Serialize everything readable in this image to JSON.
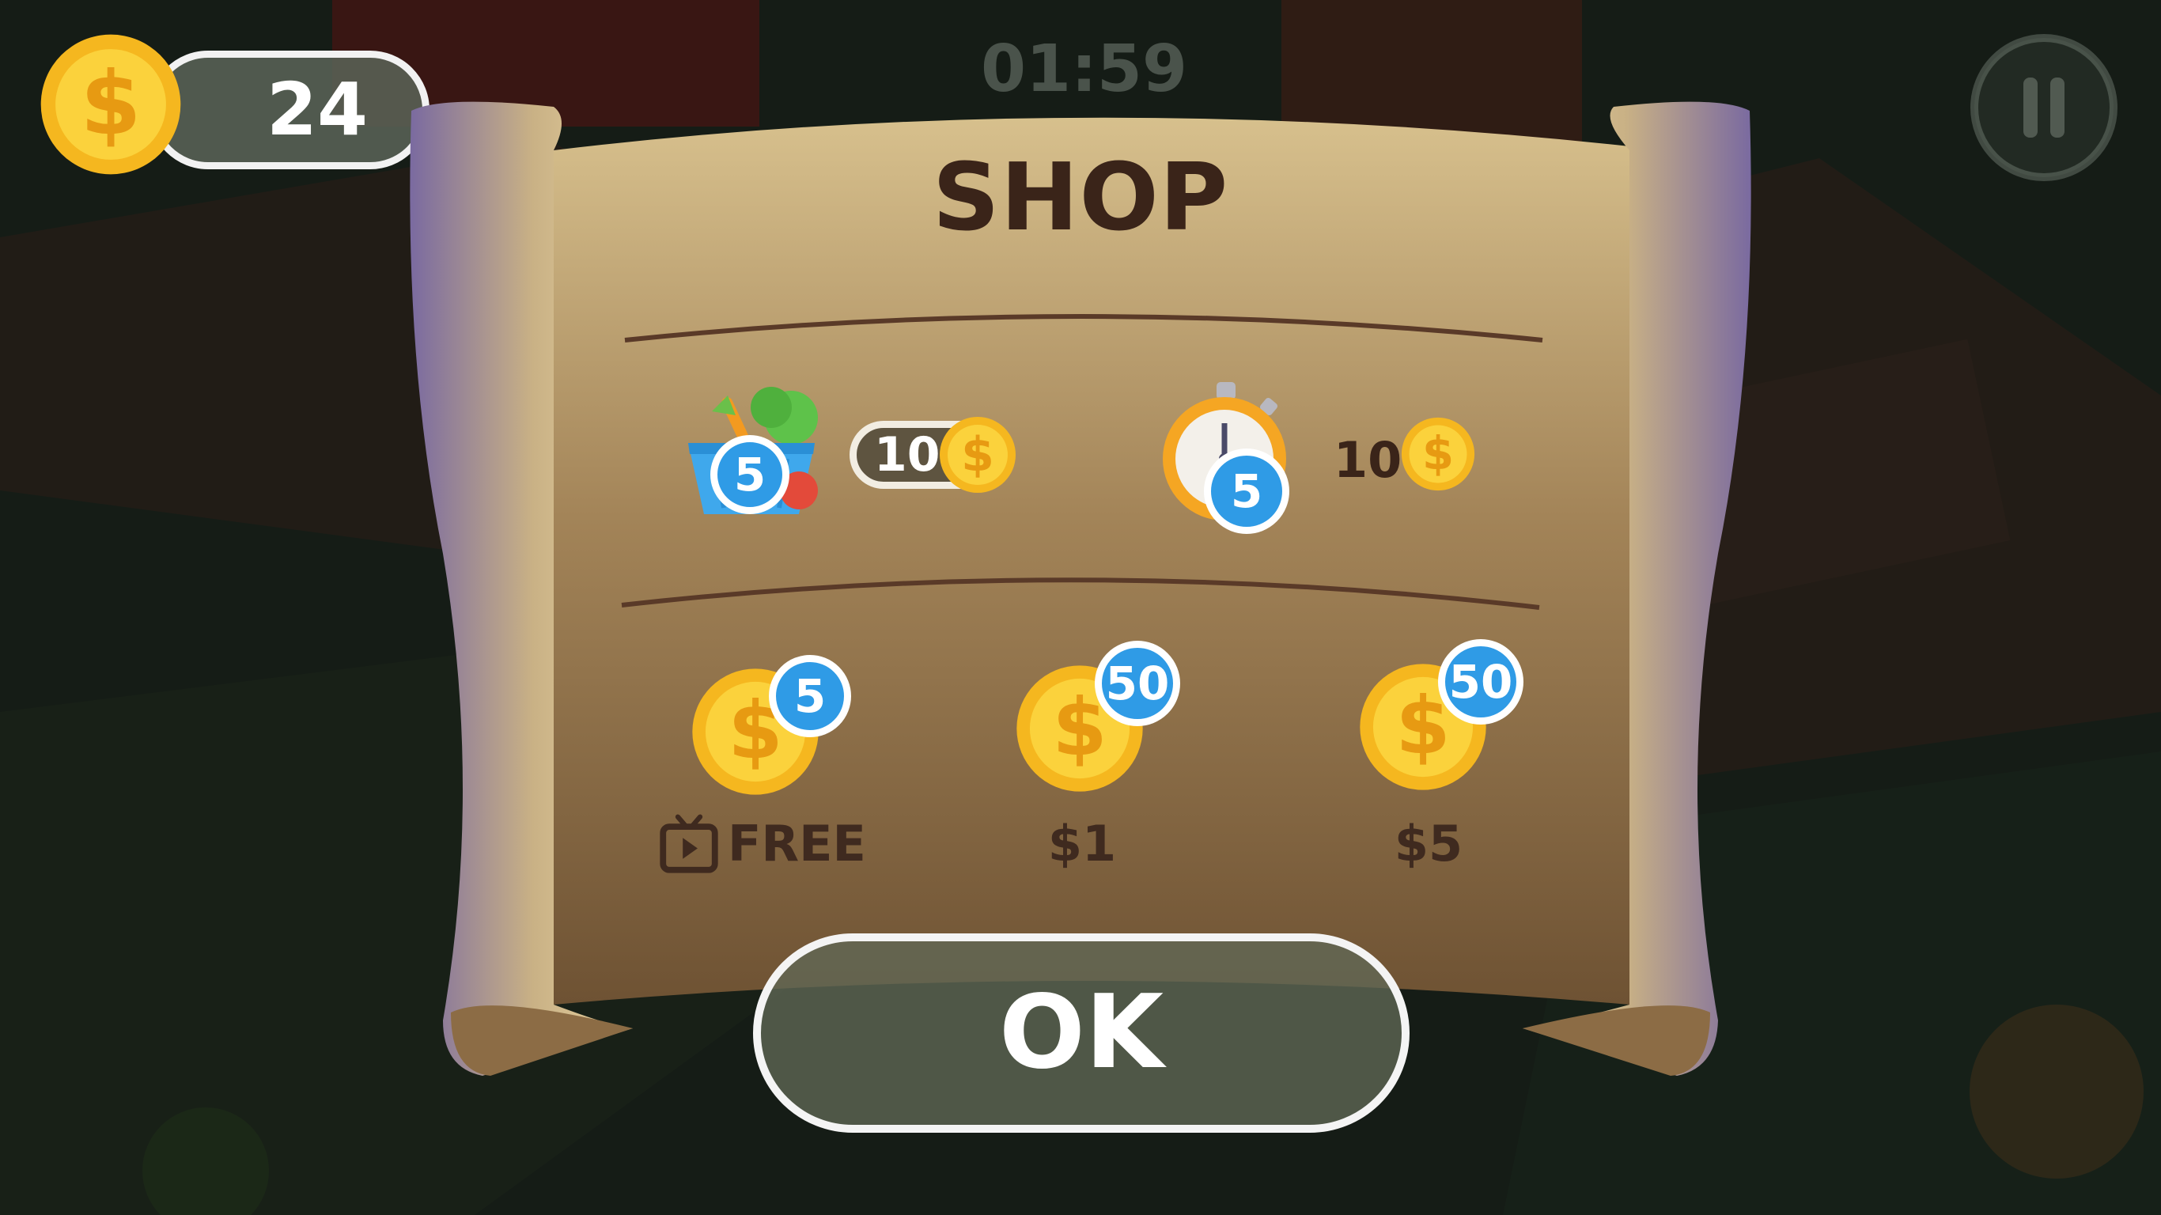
{
  "hud": {
    "coins": "24",
    "timer": "01:59",
    "pause_icon": "pause-icon",
    "coin_icon": "dollar-coin-icon"
  },
  "shop": {
    "title": "SHOP",
    "items": [
      {
        "icon": "vegetable-basket-icon",
        "badge": "5",
        "price": "10",
        "price_icon": "dollar-coin-icon"
      },
      {
        "icon": "stopwatch-icon",
        "badge": "5",
        "price": "10",
        "price_icon": "dollar-coin-icon"
      }
    ],
    "offers": [
      {
        "icon": "dollar-coin-icon",
        "badge": "5",
        "label": "FREE",
        "label_icon": "tv-play-icon"
      },
      {
        "icon": "dollar-coin-icon",
        "badge": "50",
        "label": "$1"
      },
      {
        "icon": "dollar-coin-icon",
        "badge": "50",
        "label": "$5"
      }
    ],
    "ok_label": "OK"
  },
  "colors": {
    "parchment": "#a88a60",
    "title": "#3a2419",
    "badge": "#2f9be6",
    "coin": "#f7c62a"
  }
}
